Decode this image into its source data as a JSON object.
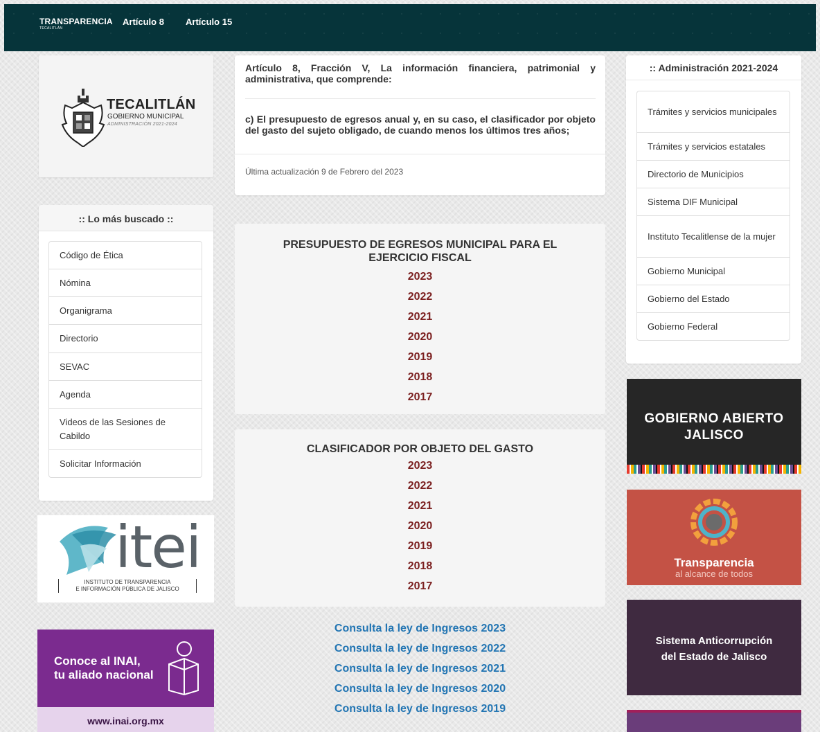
{
  "topbar": {
    "brand": "TRANSPARENCIA",
    "brand_sub": "TECALITLÁN",
    "nav": [
      "Artículo 8",
      "Artículo 15"
    ]
  },
  "logo": {
    "title": "TECALITLÁN",
    "subtitle": "GOBIERNO MUNICIPAL",
    "admin": "ADMINISTRACIÓN 2021-2024"
  },
  "search": {
    "heading": ":: Lo más buscado ::",
    "items": [
      "Código de Ética",
      "Nómina",
      "Organigrama",
      "Directorio",
      "SEVAC",
      "Agenda",
      "Videos de las Sesiones de Cabildo",
      "Solicitar Información"
    ]
  },
  "itei": {
    "word": "itei",
    "caption_1": "INSTITUTO DE TRANSPARENCIA",
    "caption_2": "E INFORMACIÓN PÚBLICA DE JALISCO"
  },
  "inai": {
    "line_1": "Conoce al INAI,",
    "line_2": "tu aliado nacional",
    "url": "www.inai.org.mx"
  },
  "article": {
    "p1": "Artículo 8, Fracción V, La información financiera, patrimonial y administrativa, que comprende:",
    "p2": "c) El presupuesto de egresos anual y, en su caso, el clasificador por objeto del gasto del sujeto obligado, de cuando menos los últimos tres años;",
    "updated": "Última actualización 9 de Febrero del 2023"
  },
  "presupuesto": {
    "title_1": "PRESUPUESTO DE EGRESOS MUNICIPAL PARA EL",
    "title_2": "EJERCICIO FISCAL",
    "years": [
      "2023",
      "2022",
      "2021",
      "2020",
      "2019",
      "2018",
      "2017"
    ]
  },
  "clasificador": {
    "title": "CLASIFICADOR POR OBJETO DEL GASTO",
    "years": [
      "2023",
      "2022",
      "2021",
      "2020",
      "2019",
      "2018",
      "2017"
    ]
  },
  "ley_links": [
    "Consulta la ley de Ingresos 2023",
    "Consulta la ley de Ingresos 2022",
    "Consulta la ley de Ingresos 2021",
    "Consulta la ley de Ingresos 2020",
    "Consulta la ley de Ingresos 2019"
  ],
  "admin": {
    "heading": ":: Administración 2021-2024",
    "items": [
      "Trámites y servicios municipales",
      "Trámites y servicios estatales",
      "Directorio de Municipios",
      "Sistema DIF Municipal",
      "Instituto Tecalitlense de la mujer",
      "Gobierno Municipal",
      "Gobierno del Estado",
      "Gobierno Federal"
    ]
  },
  "banners": {
    "gaj_1": "GOBIERNO ABIERTO",
    "gaj_2": "JALISCO",
    "transp_title": "Transparencia",
    "transp_sub": "al alcance de todos",
    "sae_1": "Sistema Anticorrupción",
    "sae_2": "del Estado de Jalisco"
  },
  "colors": {
    "topbar": "#06343a",
    "year_link": "#7b1f1f",
    "ley_link": "#2275b3",
    "inai": "#7b2b8f"
  }
}
